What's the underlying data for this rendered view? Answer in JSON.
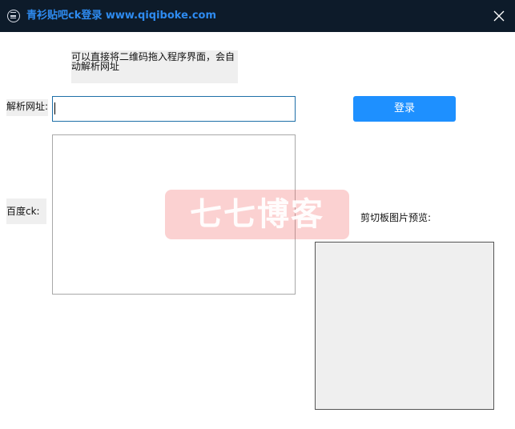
{
  "window": {
    "title": "青衫贴吧ck登录 www.qiqiboke.com",
    "app_icon": "app-logo-icon",
    "close_icon": "close-icon"
  },
  "hint": {
    "text": "可以直接将二维码拖入程序界面，会自动解析网址"
  },
  "url_field": {
    "label": "解析网址:",
    "value": "",
    "placeholder": ""
  },
  "login": {
    "label": "登录",
    "color": "#1e90ff"
  },
  "ck_field": {
    "label": "百度ck:",
    "value": ""
  },
  "preview": {
    "label": "剪切板图片预览:"
  },
  "watermark": {
    "text": "七七博客"
  },
  "colors": {
    "titlebar_bg": "#0d1b2a",
    "title_text": "#2e8bf0",
    "accent": "#1e90ff"
  }
}
